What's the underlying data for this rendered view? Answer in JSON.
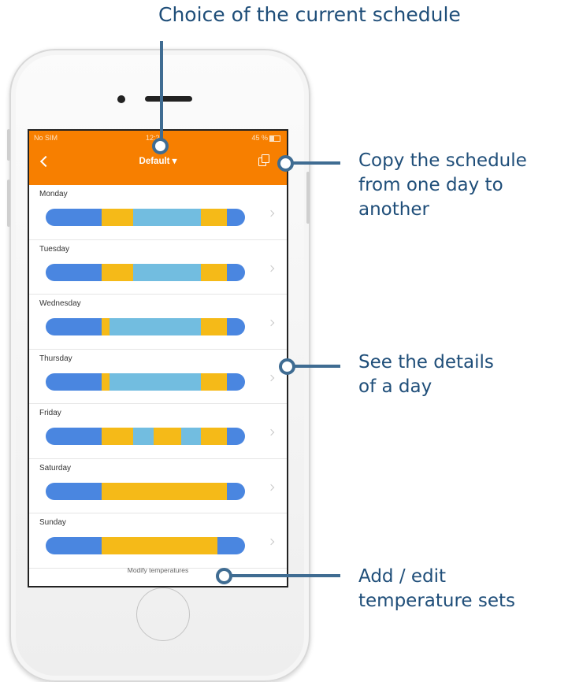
{
  "annotations": {
    "schedule_choice": "Choice of the current schedule",
    "copy": "Copy the schedule\nfrom one day to\nanother",
    "details": "See the details\nof a day",
    "temperatures": "Add / edit\ntemperature sets"
  },
  "status_bar": {
    "carrier": "No SIM",
    "time": "12:2",
    "battery": "45 %"
  },
  "header": {
    "title": "Default ▾"
  },
  "colors": {
    "accent": "#f77f00",
    "blue": "#4a86e0",
    "yellow": "#f5ba18",
    "light_blue": "#72bde0",
    "annotation": "#1f4e79"
  },
  "days": [
    {
      "label": "Monday",
      "segments": [
        [
          "blue",
          0.28
        ],
        [
          "yellow",
          0.16
        ],
        [
          "light_blue",
          0.34
        ],
        [
          "yellow",
          0.13
        ],
        [
          "blue",
          0.09
        ]
      ]
    },
    {
      "label": "Tuesday",
      "segments": [
        [
          "blue",
          0.28
        ],
        [
          "yellow",
          0.16
        ],
        [
          "light_blue",
          0.34
        ],
        [
          "yellow",
          0.13
        ],
        [
          "blue",
          0.09
        ]
      ]
    },
    {
      "label": "Wednesday",
      "segments": [
        [
          "blue",
          0.28
        ],
        [
          "yellow",
          0.04
        ],
        [
          "light_blue",
          0.46
        ],
        [
          "yellow",
          0.13
        ],
        [
          "blue",
          0.09
        ]
      ]
    },
    {
      "label": "Thursday",
      "segments": [
        [
          "blue",
          0.28
        ],
        [
          "yellow",
          0.04
        ],
        [
          "light_blue",
          0.46
        ],
        [
          "yellow",
          0.13
        ],
        [
          "blue",
          0.09
        ]
      ]
    },
    {
      "label": "Friday",
      "segments": [
        [
          "blue",
          0.28
        ],
        [
          "yellow",
          0.16
        ],
        [
          "light_blue",
          0.1
        ],
        [
          "yellow",
          0.14
        ],
        [
          "light_blue",
          0.1
        ],
        [
          "yellow",
          0.13
        ],
        [
          "blue",
          0.09
        ]
      ]
    },
    {
      "label": "Saturday",
      "segments": [
        [
          "blue",
          0.28
        ],
        [
          "yellow",
          0.63
        ],
        [
          "blue",
          0.09
        ]
      ]
    },
    {
      "label": "Sunday",
      "segments": [
        [
          "blue",
          0.28
        ],
        [
          "yellow",
          0.58
        ],
        [
          "blue",
          0.14
        ]
      ]
    }
  ],
  "footer": {
    "link": "Modify temperatures"
  }
}
